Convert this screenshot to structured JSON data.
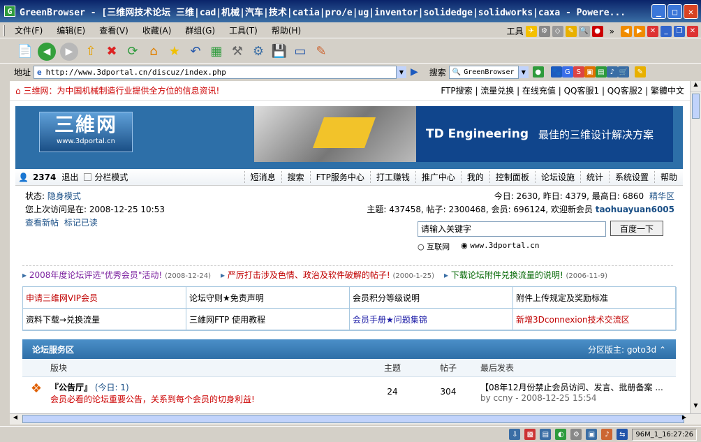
{
  "window": {
    "title": "GreenBrowser - [三维网技术论坛 三维|cad|机械|汽车|技术|catia|pro/e|ug|inventor|solidedge|solidworks|caxa - Powere..."
  },
  "menu": [
    "文件(F)",
    "编辑(E)",
    "查看(V)",
    "收藏(A)",
    "群组(G)",
    "工具(T)",
    "帮助(H)"
  ],
  "toolbar_right_label": "工具",
  "address": {
    "label": "地址",
    "url": "http://www.3dportal.cn/discuz/index.php"
  },
  "search": {
    "label": "搜索",
    "engine": "GreenBrowser"
  },
  "site": {
    "slogan": "三维网：为中国机械制造行业提供全方位的信息资讯!",
    "top_links": "FTP搜索 | 流量兑换 | 在线充值 | QQ客服1 | QQ客服2 | 繁體中文",
    "logo_main": "三維网",
    "logo_sub": "www.3dportal.cn",
    "banner_title": "TD Engineering",
    "banner_sub": "最佳的三维设计解决方案"
  },
  "nav": {
    "user_id": "2374",
    "logout": "退出",
    "split_mode": "分栏模式",
    "items": [
      "短消息",
      "搜索",
      "FTP服务中心",
      "打工赚钱",
      "推广中心",
      "我的",
      "控制面板",
      "论坛设施",
      "统计",
      "系统设置",
      "帮助"
    ]
  },
  "info": {
    "status_label": "状态:",
    "status_value": "隐身模式",
    "last_visit": "您上次访问是在: 2008-12-25 10:53",
    "new_posts": "查看新帖",
    "mark_read": "标记已读",
    "today": "今日: 2630, 昨日: 4379, 最高日: 6860",
    "elite": "精华区",
    "stats": "主题: 437458, 帖子: 2300468, 会员: 696124, 欢迎新会员",
    "new_member": "taohuayuan6005",
    "search_placeholder": "请输入关键字",
    "search_button": "百度一下",
    "radio1": "互联网",
    "radio2": "www.3dportal.cn"
  },
  "announcements": [
    {
      "text": "2008年度论坛评选\"优秀会员\"活动!",
      "date": "(2008-12-24)",
      "color": "#7a1f9e"
    },
    {
      "text": "严厉打击涉及色情、政治及软件破解的帖子!",
      "date": "(2000-1-25)",
      "color": "#c00000"
    },
    {
      "text": "下载论坛附件兑换流量的说明!",
      "date": "(2006-11-9)",
      "color": "#006600"
    }
  ],
  "links": [
    {
      "text": "申请三维网VIP会员",
      "color": "#c00000"
    },
    {
      "text": "论坛守则★免责声明",
      "color": "#000000"
    },
    {
      "text": "会员积分等级说明",
      "color": "#000000"
    },
    {
      "text": "附件上传规定及奖励标准",
      "color": "#000000"
    },
    {
      "text": "资料下载→兑换流量",
      "color": "#000000"
    },
    {
      "text": "三維网FTP 使用教程",
      "color": "#000000"
    },
    {
      "text": "会员手册★问题集锦",
      "color": "#1a1aa6"
    },
    {
      "text": "新增3Dconnexion技术交流区",
      "color": "#c00000"
    }
  ],
  "forum": {
    "section": "论坛服务区",
    "moderator": "分区版主: goto3d",
    "cols": [
      "版块",
      "主题",
      "帖子",
      "最后发表"
    ],
    "row": {
      "name": "『公告厅』",
      "today": "(今日: 1)",
      "desc": "会员必看的论坛重要公告，关系到每个会员的切身利益!",
      "topics": "24",
      "posts": "304",
      "last": "【08年12月份禁止会员访问、发言、批册备案 ...",
      "last_by": "by ccny - 2008-12-25 15:54"
    }
  },
  "statusbar": {
    "clock": "96M_1_16:27:26"
  }
}
